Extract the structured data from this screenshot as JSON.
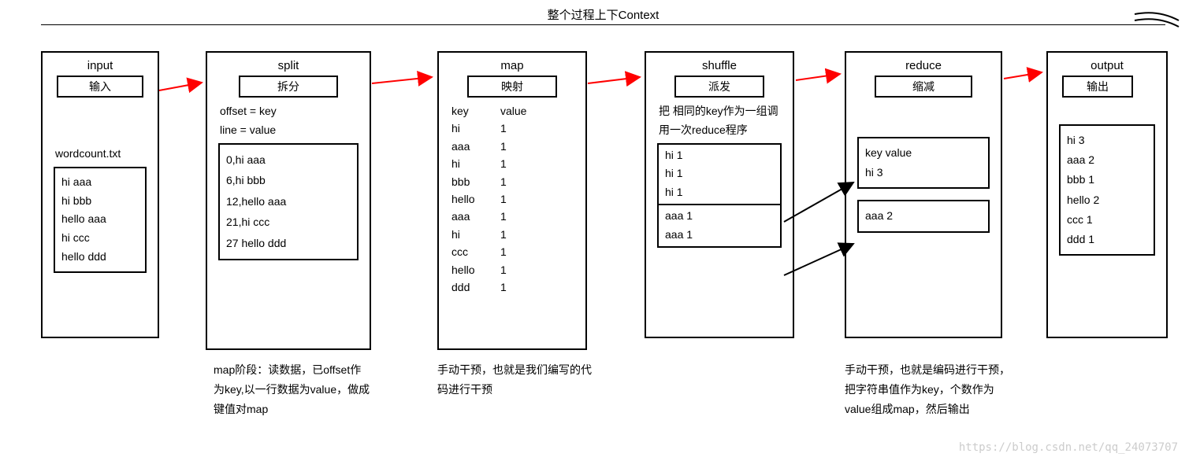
{
  "title": "整个过程上下Context",
  "stages": {
    "input": {
      "title": "input",
      "sub": "输入",
      "filelabel": "wordcount.txt",
      "lines": [
        "hi aaa",
        "hi bbb",
        "hello aaa",
        "hi ccc",
        "hello ddd"
      ]
    },
    "split": {
      "title": "split",
      "sub": "拆分",
      "meta1": "offset = key",
      "meta2": "line = value",
      "lines": [
        "0,hi aaa",
        "6,hi bbb",
        "12,hello aaa",
        "21,hi ccc",
        "27 hello ddd"
      ],
      "note": "map阶段：读数据，已offset作为key,以一行数据为value，做成键值对map"
    },
    "map": {
      "title": "map",
      "sub": "映射",
      "header_key": "key",
      "header_val": "value",
      "rows": [
        {
          "k": "hi",
          "v": "1"
        },
        {
          "k": "aaa",
          "v": "1"
        },
        {
          "k": "hi",
          "v": "1"
        },
        {
          "k": "bbb",
          "v": "1"
        },
        {
          "k": "hello",
          "v": "1"
        },
        {
          "k": "aaa",
          "v": "1"
        },
        {
          "k": "hi",
          "v": "1"
        },
        {
          "k": "ccc",
          "v": "1"
        },
        {
          "k": "hello",
          "v": "1"
        },
        {
          "k": "ddd",
          "v": "1"
        }
      ],
      "note": "手动干预，也就是我们编写的代码进行干预"
    },
    "shuffle": {
      "title": "shuffle",
      "sub": "派发",
      "desc": "把 相同的key作为一组调用一次reduce程序",
      "group1": [
        "hi  1",
        "hi  1",
        "hi  1"
      ],
      "group2": [
        "aaa  1",
        "aaa  1"
      ]
    },
    "reduce": {
      "title": "reduce",
      "sub": "缩减",
      "g1_header": "key   value",
      "g1_row": "hi        3",
      "g2_row": "aaa    2",
      "note": "手动干预，也就是编码进行干预，把字符串值作为key，个数作为value组成map，然后输出"
    },
    "output": {
      "title": "output",
      "sub": "输出",
      "lines": [
        "hi   3",
        "aaa 2",
        "bbb 1",
        "hello 2",
        "ccc   1",
        "ddd 1"
      ]
    }
  },
  "watermark": "https://blog.csdn.net/qq_24073707"
}
